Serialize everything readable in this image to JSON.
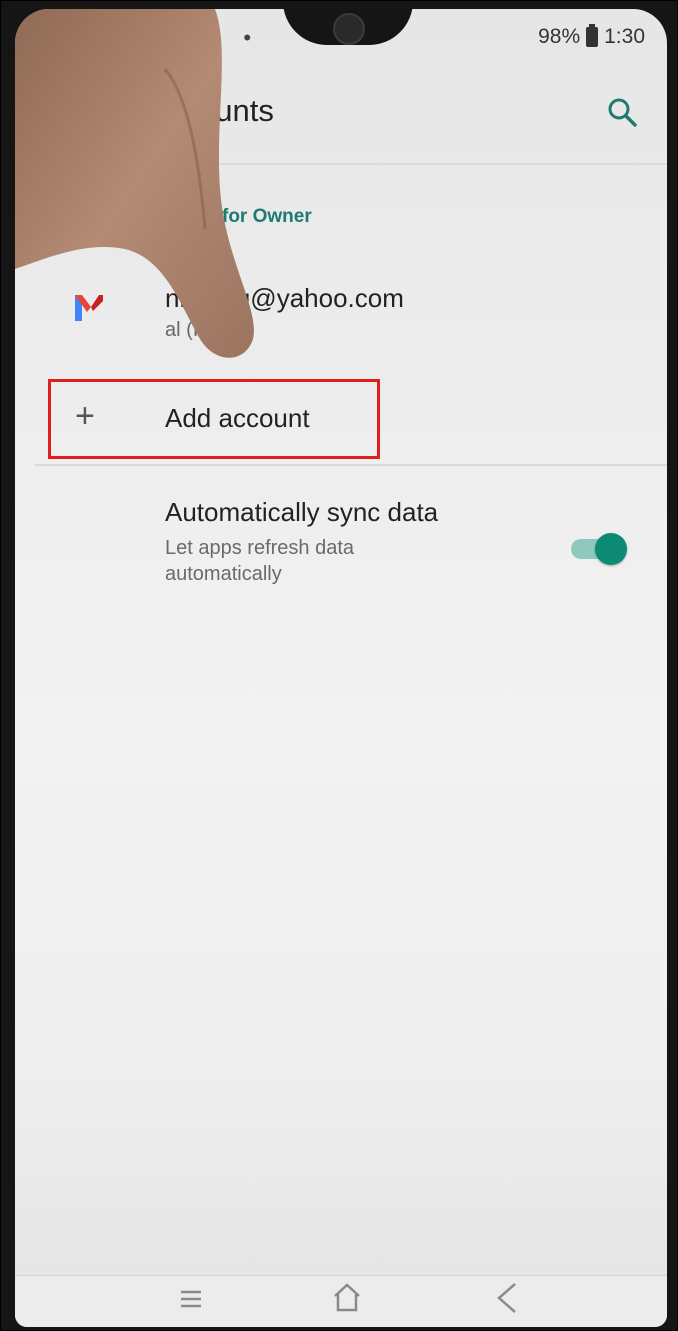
{
  "status_bar": {
    "left_icons": "⌆ ⤓ •",
    "battery_percent": "98%",
    "time": "1:30"
  },
  "app_bar": {
    "title": "ccounts",
    "search_icon": "search-icon"
  },
  "section": {
    "header": "ounts for Owner"
  },
  "account": {
    "email": "nn4you@yahoo.com",
    "type": "al (IMAP)",
    "icon": "gmail-icon"
  },
  "add_account": {
    "label": "Add account",
    "icon": "plus-icon"
  },
  "sync": {
    "title": "Automatically sync data",
    "subtitle": "Let apps refresh data automatically",
    "enabled": true
  },
  "colors": {
    "accent": "#0c8a73",
    "highlight": "#e01e1e"
  }
}
